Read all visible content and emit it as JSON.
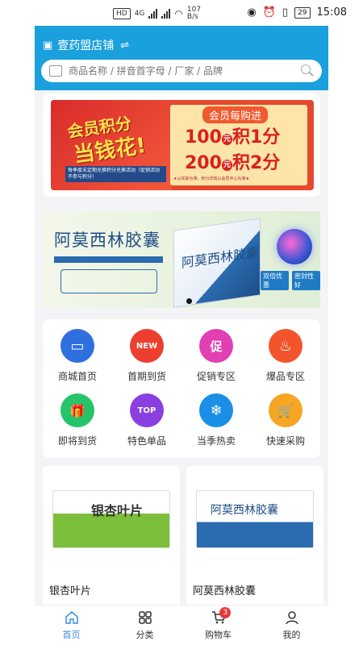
{
  "status_bar": {
    "network_left": "HD",
    "network_gen": "4G",
    "speed": "107",
    "speed_unit": "B/s",
    "battery": "29",
    "time": "15:08"
  },
  "header": {
    "store_name": "壹药盟店铺",
    "switch_icon": "⇌",
    "search_placeholder": "商品名称 / 拼音首字母 / 厂家 / 品牌"
  },
  "member_banner": {
    "slogan_top": "会员积分",
    "slogan_bottom": "当钱花!",
    "small_note": "每季度末定期兑换积分兑换活动（促销活动不参与积分）",
    "ticket_title": "会员每购进",
    "rows": [
      {
        "amount": "100",
        "unit": "元",
        "text": "积1分"
      },
      {
        "amount": "200",
        "unit": "元",
        "text": "积2分"
      }
    ],
    "foot_note": "★以实际为准，积分详情以会员中心为准★"
  },
  "drug_banner": {
    "title": "阿莫西林胶囊",
    "box_label": "阿莫西林胶囊",
    "badges": [
      "双倍优惠",
      "密封性好"
    ]
  },
  "grid": {
    "items": [
      {
        "label": "商城首页",
        "icon": "monitor-icon",
        "color": "#2f6fe0",
        "glyph": "▭"
      },
      {
        "label": "首期到货",
        "icon": "new-icon",
        "color": "#ec3f2f",
        "glyph": "NEW"
      },
      {
        "label": "促销专区",
        "icon": "promo-tag-icon",
        "color": "#e23fb3",
        "glyph": "促"
      },
      {
        "label": "爆品专区",
        "icon": "flame-icon",
        "color": "#f2542b",
        "glyph": "♨"
      },
      {
        "label": "即将到货",
        "icon": "gift-icon",
        "color": "#25c46b",
        "glyph": "🎁"
      },
      {
        "label": "特色单品",
        "icon": "top-crown-icon",
        "color": "#8a3fe0",
        "glyph": "TOP"
      },
      {
        "label": "当季热卖",
        "icon": "snowflake-sun-icon",
        "color": "#1a8fe5",
        "glyph": "❄"
      },
      {
        "label": "快速采购",
        "icon": "cart-icon",
        "color": "#f5a623",
        "glyph": "🛒"
      }
    ]
  },
  "products": [
    {
      "name": "银杏叶片",
      "image_text": "银杏叶片"
    },
    {
      "name": "阿莫西林胶囊",
      "image_text": "阿莫西林胶囊"
    }
  ],
  "nav": {
    "items": [
      {
        "label": "首页",
        "icon": "home-icon"
      },
      {
        "label": "分类",
        "icon": "grid-icon"
      },
      {
        "label": "购物车",
        "icon": "cart-icon"
      },
      {
        "label": "我的",
        "icon": "user-icon"
      }
    ],
    "cart_badge": "3"
  },
  "colors": {
    "header": "#1aa0dc",
    "accent": "#3a8dde",
    "badge": "#e53935"
  }
}
